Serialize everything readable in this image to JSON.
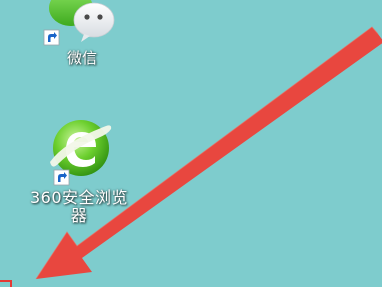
{
  "desktop": {
    "background_color": "#7ecccd",
    "icons": [
      {
        "label": "微信",
        "icon": "wechat-icon"
      },
      {
        "label": "360安全浏览器",
        "icon": "browser-icon"
      }
    ]
  },
  "annotation": {
    "arrow_color": "#e8473f",
    "description_icon": "red-arrow"
  }
}
